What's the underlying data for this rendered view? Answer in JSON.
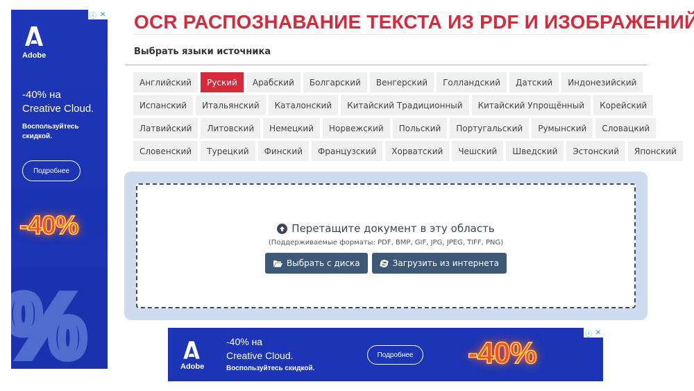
{
  "title": "OCR РАСПОЗНАВАНИЕ ТЕКСТА ИЗ PDF И ИЗОБРАЖЕНИЙ",
  "section_label": "Выбрать языки источника",
  "languages": [
    [
      "Английский",
      "Руский",
      "Арабский",
      "Болгарский",
      "Венгерский",
      "Голландский",
      "Датский",
      "Индонезийский"
    ],
    [
      "Испанский",
      "Итальянский",
      "Каталонский",
      "Китайский Традиционный",
      "Китайский Упрощённый",
      "Корейский"
    ],
    [
      "Латвийский",
      "Литовский",
      "Немецкий",
      "Норвежский",
      "Польский",
      "Португальский",
      "Румынский",
      "Словацкий"
    ],
    [
      "Словенский",
      "Турецкий",
      "Финский",
      "Французский",
      "Хорватский",
      "Чешский",
      "Шведский",
      "Эстонский",
      "Японский"
    ]
  ],
  "selected_language": "Руский",
  "dropzone": {
    "title": "Перетащите документ в эту область",
    "formats": "(Поддерживаемые форматы: PDF, BMP, GIF, JPG, JPEG, TIFF, PNG)",
    "btn_disk": "Выбрать с диска",
    "btn_web": "Загрузить из интернета"
  },
  "ad_left": {
    "brand": "Adobe",
    "headline_1": "-40% на",
    "headline_2": "Creative Cloud.",
    "sub": "Воспользуйтесь скидкой.",
    "cta": "Подробнее",
    "badge": "-40%",
    "info_icon": "ⓘ",
    "close_icon": "✕"
  },
  "ad_bottom": {
    "brand": "Adobe",
    "headline_1": "-40% на",
    "headline_2": "Creative Cloud.",
    "sub": "Воспользуйтесь скидкой.",
    "cta": "Подробнее",
    "badge": "-40%",
    "info_icon": "ⓘ",
    "close_icon": "✕"
  },
  "colors": {
    "accent": "#d8293b",
    "button": "#3e5877",
    "ad_blue": "#1b35b6",
    "drop_bg": "#cfdcef"
  },
  "icons": {
    "upload": "upload-circle-icon",
    "folder": "folder-open-icon",
    "web": "internet-explorer-icon",
    "adobe": "adobe-logo-icon"
  }
}
